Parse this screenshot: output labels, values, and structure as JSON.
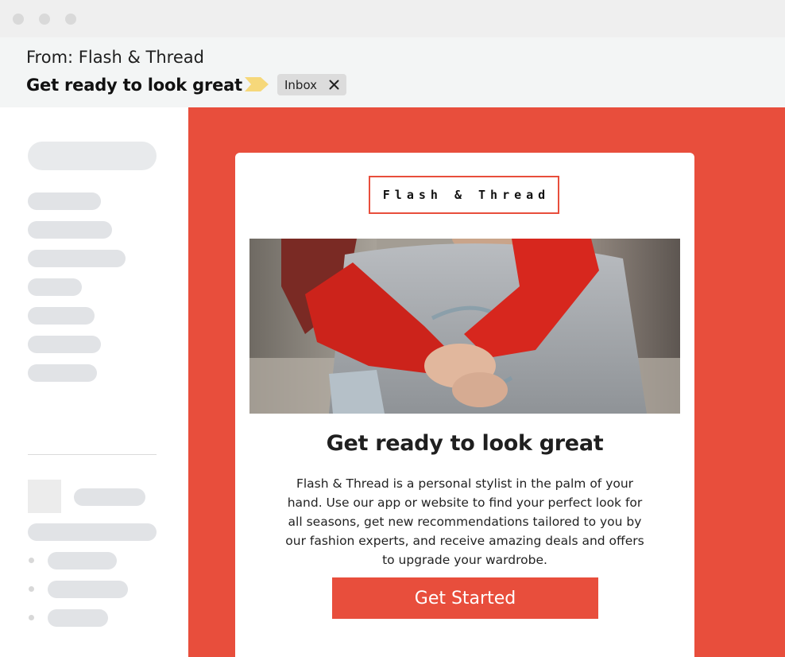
{
  "window": {
    "controls": [
      "close",
      "minimize",
      "maximize"
    ]
  },
  "email": {
    "from": "From: Flash & Thread",
    "subject": "Get ready to look great",
    "importance_icon": "importance-marker-icon",
    "label": "Inbox",
    "label_close_icon": "close-icon"
  },
  "sidebar": {
    "placeholder_note": "gray skeleton placeholders, no text"
  },
  "card": {
    "logo": "Flash & Thread",
    "hero_image": "couple-piggyback-photo",
    "title": "Get ready to look great",
    "body": "Flash & Thread is a personal stylist in the palm of your hand. Use our app or website to find your perfect look for all seasons, get new recommendations tailored to you by our fashion experts, and receive amazing deals and offers to upgrade your wardrobe.",
    "cta_label": "Get Started"
  },
  "colors": {
    "accent": "#e84e3c",
    "tag": "#f6d87a",
    "chip": "#dcdcdc",
    "placeholder": "#e1e3e6"
  }
}
